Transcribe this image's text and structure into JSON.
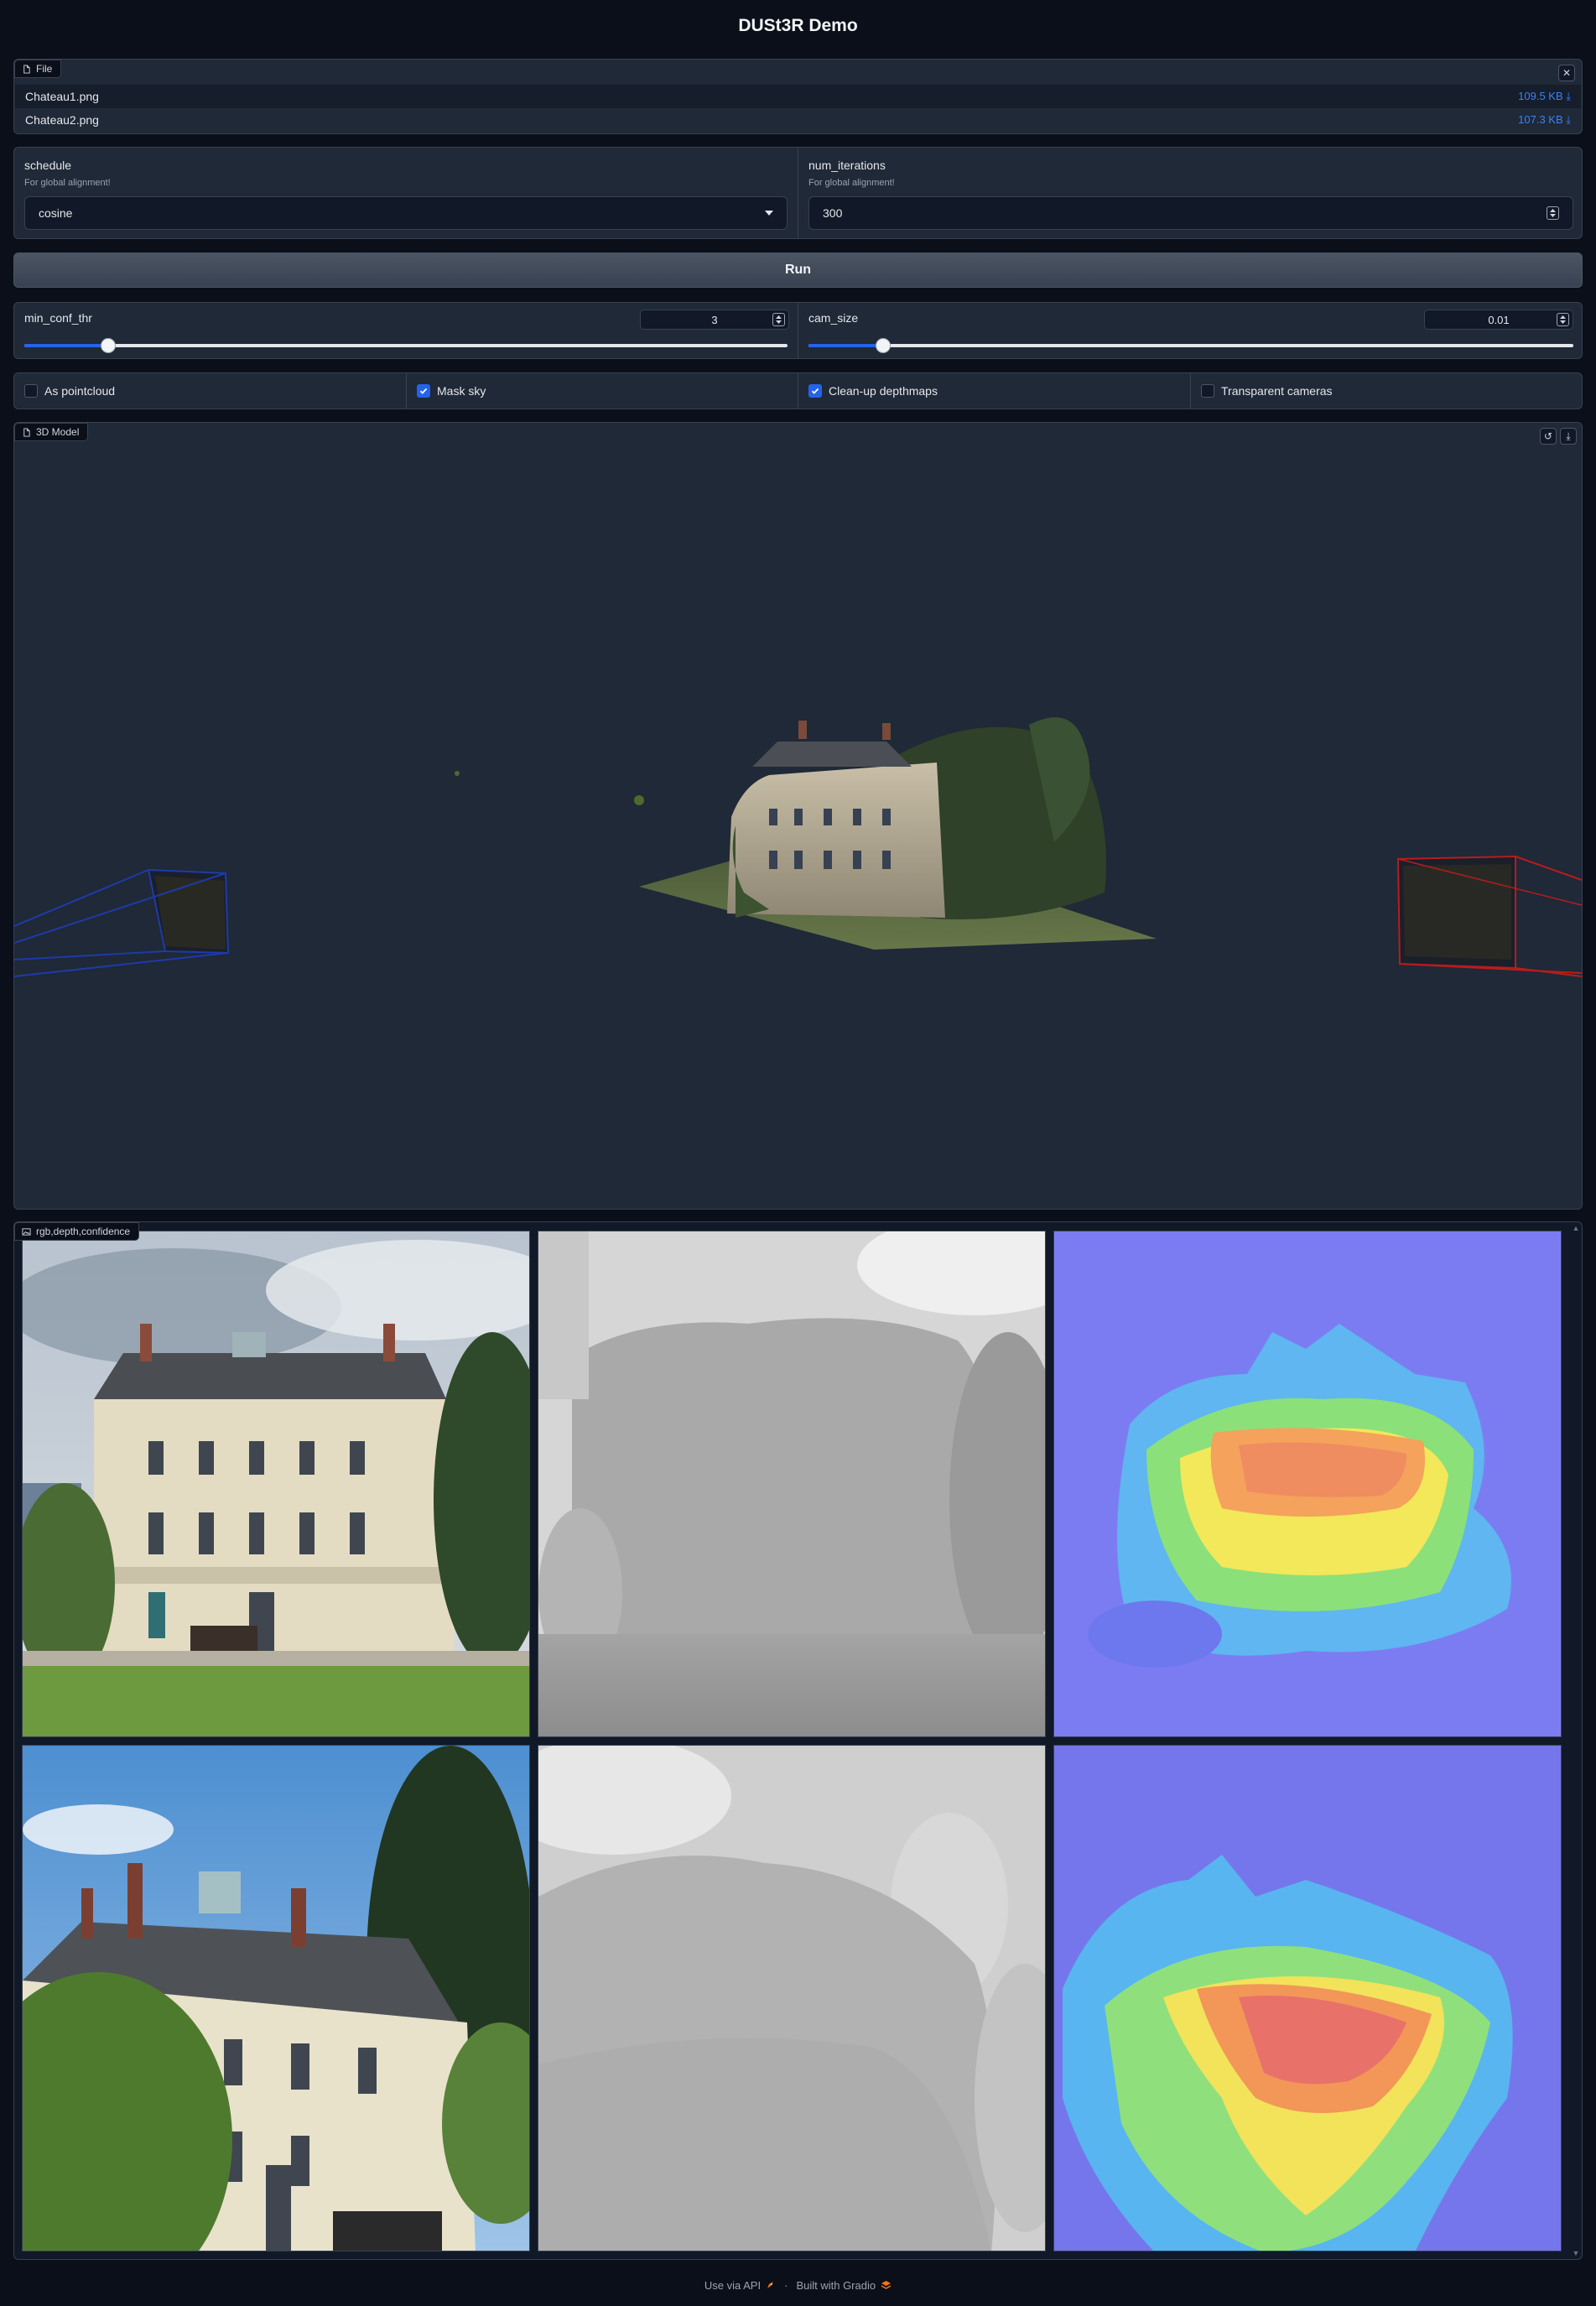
{
  "app": {
    "title": "DUSt3R Demo"
  },
  "file_block": {
    "label": "File",
    "files": [
      {
        "name": "Chateau1.png",
        "size": "109.5 KB ⤓"
      },
      {
        "name": "Chateau2.png",
        "size": "107.3 KB ⤓"
      }
    ],
    "clear_icon": "close-icon"
  },
  "schedule": {
    "label": "schedule",
    "info": "For global alignment!",
    "value": "cosine"
  },
  "num_iterations": {
    "label": "num_iterations",
    "info": "For global alignment!",
    "value": "300"
  },
  "run_label": "Run",
  "min_conf_thr": {
    "label": "min_conf_thr",
    "value": "3",
    "level": 0.11
  },
  "cam_size": {
    "label": "cam_size",
    "value": "0.01",
    "level": 0.098
  },
  "options": [
    {
      "label": "As pointcloud",
      "checked": false
    },
    {
      "label": "Mask sky",
      "checked": true
    },
    {
      "label": "Clean-up depthmaps",
      "checked": true
    },
    {
      "label": "Transparent cameras",
      "checked": false
    }
  ],
  "model_block": {
    "label": "3D Model",
    "icons": [
      "undo-icon",
      "download-icon"
    ]
  },
  "gallery": {
    "label": "rgb,depth,confidence",
    "items": [
      "rgb",
      "depth",
      "confidence",
      "rgb",
      "depth",
      "confidence"
    ]
  },
  "colors": {
    "background": "#0b0f19",
    "panel": "#1f2937",
    "accent": "#2563eb",
    "link": "#3b82f6",
    "camera1": "#1e3aaa",
    "camera2": "#b91c1c"
  },
  "footer": {
    "api": "Use via API",
    "sep": "·",
    "built": "Built with Gradio"
  }
}
